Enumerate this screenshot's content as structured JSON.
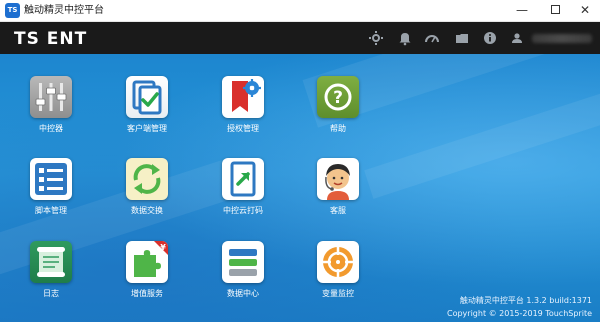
{
  "window": {
    "app_icon_text": "TS",
    "title": "触动精灵中控平台",
    "minimize": "—",
    "close": "✕"
  },
  "header": {
    "logo_text": "TS ENT",
    "icons": [
      "settings-icon",
      "bell-icon",
      "speedometer-icon",
      "folder-icon",
      "info-icon",
      "user-icon"
    ]
  },
  "tiles": [
    {
      "label": "中控器",
      "icon": "sliders-icon"
    },
    {
      "label": "客户端管理",
      "icon": "client-check-icon"
    },
    {
      "label": "授权管理",
      "icon": "authorize-icon"
    },
    {
      "label": "帮助",
      "icon": "help-icon"
    },
    {
      "label": "脚本管理",
      "icon": "script-list-icon"
    },
    {
      "label": "数据交换",
      "icon": "exchange-icon"
    },
    {
      "label": "中控云打码",
      "icon": "cloud-code-icon"
    },
    {
      "label": "客服",
      "icon": "customer-service-icon"
    },
    {
      "label": "日志",
      "icon": "log-icon"
    },
    {
      "label": "增值服务",
      "icon": "value-added-icon"
    },
    {
      "label": "数据中心",
      "icon": "data-center-icon"
    },
    {
      "label": "变量监控",
      "icon": "variable-monitor-icon"
    }
  ],
  "footer": {
    "version": "触动精灵中控平台 1.3.2 build:1371",
    "copyright": "Copyright © 2015-2019 TouchSprite"
  },
  "colors": {
    "header_bg": "#1a1a1a",
    "main_bg": "#1d86cf",
    "tile_label": "#ffffff"
  }
}
